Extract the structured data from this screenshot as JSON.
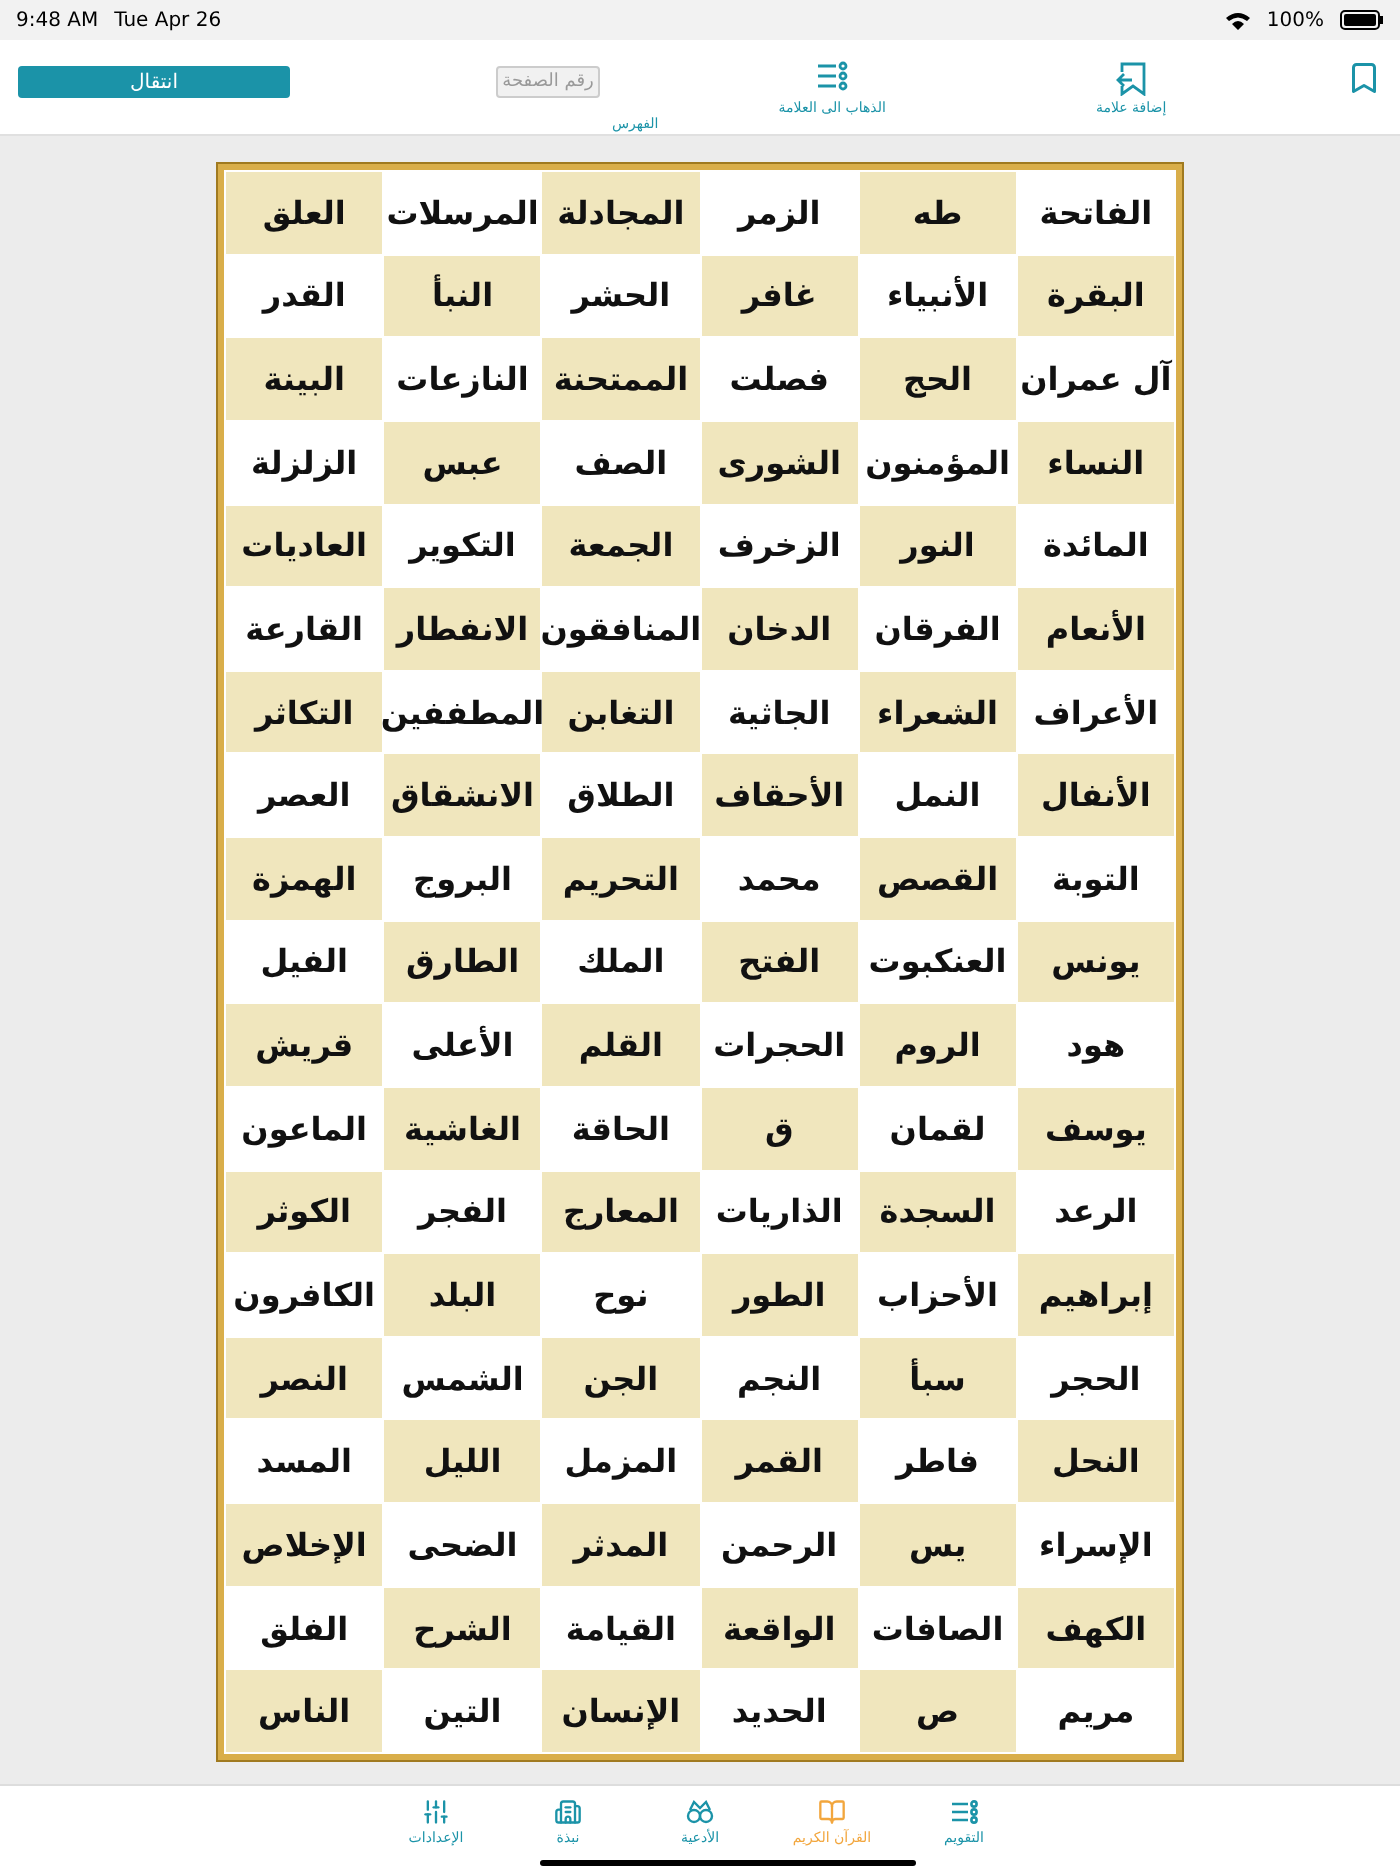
{
  "status_bar": {
    "time": "9:48 AM",
    "date": "Tue Apr 26",
    "battery": "100%"
  },
  "toolbar": {
    "go_button": "انتقال",
    "page_field": {
      "placeholder": "رقم الصفحة"
    },
    "index_label": "الفهرس",
    "goto_bookmark": "الذهاب الى العلامة",
    "add_bookmark": "إضافة علامة"
  },
  "surah_columns": [
    [
      "الفاتحة",
      "البقرة",
      "آل عمران",
      "النساء",
      "المائدة",
      "الأنعام",
      "الأعراف",
      "الأنفال",
      "التوبة",
      "يونس",
      "هود",
      "يوسف",
      "الرعد",
      "إبراهيم",
      "الحجر",
      "النحل",
      "الإسراء",
      "الكهف",
      "مريم"
    ],
    [
      "طه",
      "الأنبياء",
      "الحج",
      "المؤمنون",
      "النور",
      "الفرقان",
      "الشعراء",
      "النمل",
      "القصص",
      "العنكبوت",
      "الروم",
      "لقمان",
      "السجدة",
      "الأحزاب",
      "سبأ",
      "فاطر",
      "يس",
      "الصافات",
      "ص"
    ],
    [
      "الزمر",
      "غافر",
      "فصلت",
      "الشورى",
      "الزخرف",
      "الدخان",
      "الجاثية",
      "الأحقاف",
      "محمد",
      "الفتح",
      "الحجرات",
      "ق",
      "الذاريات",
      "الطور",
      "النجم",
      "القمر",
      "الرحمن",
      "الواقعة",
      "الحديد"
    ],
    [
      "المجادلة",
      "الحشر",
      "الممتحنة",
      "الصف",
      "الجمعة",
      "المنافقون",
      "التغابن",
      "الطلاق",
      "التحريم",
      "الملك",
      "القلم",
      "الحاقة",
      "المعارج",
      "نوح",
      "الجن",
      "المزمل",
      "المدثر",
      "القيامة",
      "الإنسان"
    ],
    [
      "المرسلات",
      "النبأ",
      "النازعات",
      "عبس",
      "التكوير",
      "الانفطار",
      "المطففين",
      "الانشقاق",
      "البروج",
      "الطارق",
      "الأعلى",
      "الغاشية",
      "الفجر",
      "البلد",
      "الشمس",
      "الليل",
      "الضحى",
      "الشرح",
      "التين"
    ],
    [
      "العلق",
      "القدر",
      "البينة",
      "الزلزلة",
      "العاديات",
      "القارعة",
      "التكاثر",
      "العصر",
      "الهمزة",
      "الفيل",
      "قريش",
      "الماعون",
      "الكوثر",
      "الكافرون",
      "النصر",
      "المسد",
      "الإخلاص",
      "الفلق",
      "الناس"
    ]
  ],
  "tab_bar": [
    {
      "kind": "calendar",
      "label": "التقويم",
      "selected": false
    },
    {
      "kind": "quran",
      "label": "القرآن الكريم",
      "selected": true
    },
    {
      "kind": "prayers",
      "label": "الأدعية",
      "selected": false
    },
    {
      "kind": "about",
      "label": "نبذة",
      "selected": false
    },
    {
      "kind": "settings",
      "label": "الإعدادات",
      "selected": false
    }
  ]
}
